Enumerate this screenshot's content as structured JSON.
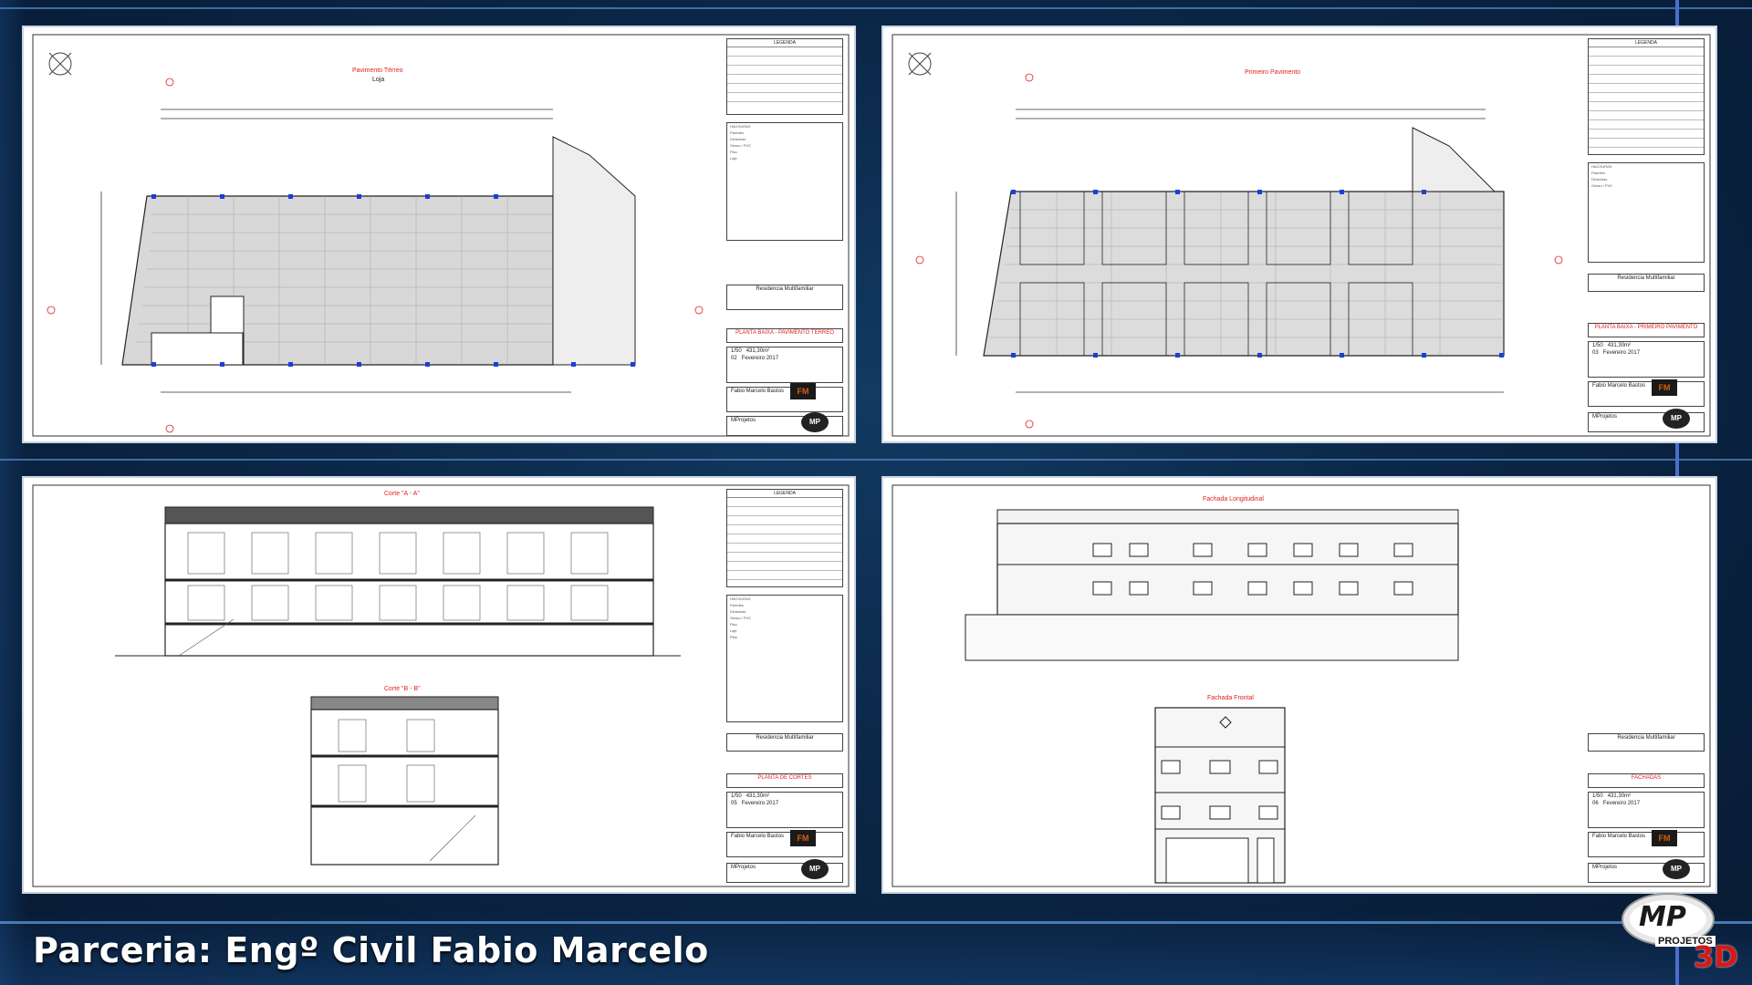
{
  "caption": "Parceria: Engº Civil Fabio Marcelo",
  "brand": {
    "mp": "MP",
    "projetos": "PROJETOS",
    "tag": "3D"
  },
  "sheets": [
    {
      "title": "Pavimento Térreo",
      "subtitle": "Loja",
      "project": "Residencia Multifamiliar",
      "plan": "PLANTA BAIXA - PAVIMENTO TÉRREO",
      "scale": "1/50",
      "area": "431,30m²",
      "date": "Fevereiro 2017",
      "sheet": "02",
      "author": "Fabio Marcelo Bastos",
      "studio": "MProjetos"
    },
    {
      "title": "Primeiro Pavimento",
      "subtitle": "",
      "project": "Residencia Multifamiliar",
      "plan": "PLANTA BAIXA - PRIMEIRO PAVIMENTO",
      "scale": "1/50",
      "area": "431,30m²",
      "date": "Fevereiro 2017",
      "sheet": "03",
      "author": "Fabio Marcelo Bastos",
      "studio": "MProjetos"
    },
    {
      "title": "Corte \"A - A\"",
      "subtitle": "Corte \"B - B\"",
      "project": "Residencia Multifamiliar",
      "plan": "PLANTA DE CORTES",
      "scale": "1/50",
      "area": "431,30m²",
      "date": "Fevereiro 2017",
      "sheet": "05",
      "author": "Fabio Marcelo Bastos",
      "studio": "MProjetos"
    },
    {
      "title": "Fachada Longitudinal",
      "subtitle": "Fachada Frontal",
      "project": "Residencia Multifamiliar",
      "plan": "FACHADAS",
      "scale": "1/50",
      "area": "431,30m²",
      "date": "Fevereiro 2017",
      "sheet": "06",
      "author": "Fabio Marcelo Bastos",
      "studio": "MProjetos"
    }
  ],
  "legend": {
    "header": "LEGENDA",
    "hatch_header": "HACHURAS",
    "cuts_header": "CORTES",
    "items": [
      "Paredes",
      "Divisórias",
      "Gesso / PVC",
      "Piso",
      "Laje",
      "Pilar",
      "Telhado",
      "Estrutura Telhado",
      "Vidro"
    ]
  },
  "colors": {
    "accent": "#e02020",
    "bg": "#0b2747",
    "line": "#4a6fd0"
  }
}
